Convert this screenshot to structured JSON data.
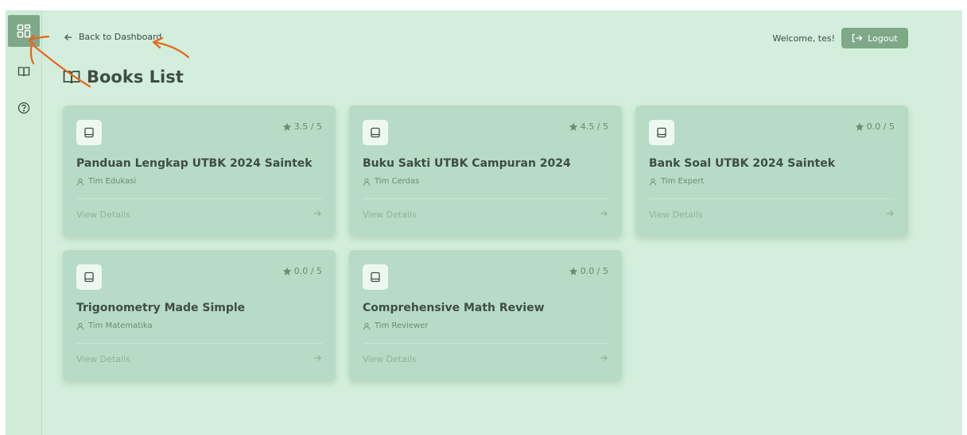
{
  "nav": {
    "back_label": "Back to Dashboard",
    "welcome": "Welcome, tes!",
    "logout_label": "Logout"
  },
  "page": {
    "title": "Books List"
  },
  "sidebar": {
    "items": [
      {
        "icon": "dashboard-grid-icon",
        "active": true
      },
      {
        "icon": "book-open-icon",
        "active": false
      },
      {
        "icon": "help-circle-icon",
        "active": false
      }
    ]
  },
  "books": [
    {
      "title": "Panduan Lengkap UTBK 2024 Saintek",
      "author": "Tim Edukasi",
      "rating": "3.5 / 5",
      "action": "View Details"
    },
    {
      "title": "Buku Sakti UTBK Campuran 2024",
      "author": "Tim Cerdas",
      "rating": "4.5 / 5",
      "action": "View Details"
    },
    {
      "title": "Bank Soal UTBK 2024 Saintek",
      "author": "Tim Expert",
      "rating": "0.0 / 5",
      "action": "View Details"
    },
    {
      "title": "Trigonometry Made Simple",
      "author": "Tim Matematika",
      "rating": "0.0 / 5",
      "action": "View Details"
    },
    {
      "title": "Comprehensive Math Review",
      "author": "Tim Reviewer",
      "rating": "0.0 / 5",
      "action": "View Details"
    }
  ],
  "colors": {
    "background": "#d3eedc",
    "card": "#b7dbc6",
    "accent": "#7fa888",
    "annotation": "#e8651c"
  }
}
